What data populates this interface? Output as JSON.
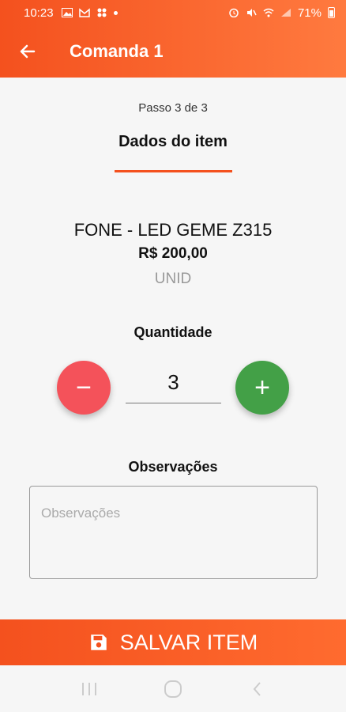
{
  "status_bar": {
    "time": "10:23",
    "battery": "71%"
  },
  "toolbar": {
    "title": "Comanda 1",
    "back_icon": "arrow-left"
  },
  "step": {
    "text": "Passo 3 de 3",
    "title": "Dados do item"
  },
  "product": {
    "name": "FONE - LED GEME Z315",
    "price": "R$ 200,00",
    "unit": "UNID"
  },
  "quantity": {
    "label": "Quantidade",
    "value": "3",
    "minus_symbol": "−",
    "plus_symbol": "+"
  },
  "observations": {
    "label": "Observações",
    "placeholder": "Observações",
    "value": ""
  },
  "save_button": {
    "label": "SALVAR ITEM",
    "icon": "floppy-disk"
  },
  "colors": {
    "accent": "#f4511e",
    "minus": "#f4525a",
    "plus": "#43a047"
  }
}
